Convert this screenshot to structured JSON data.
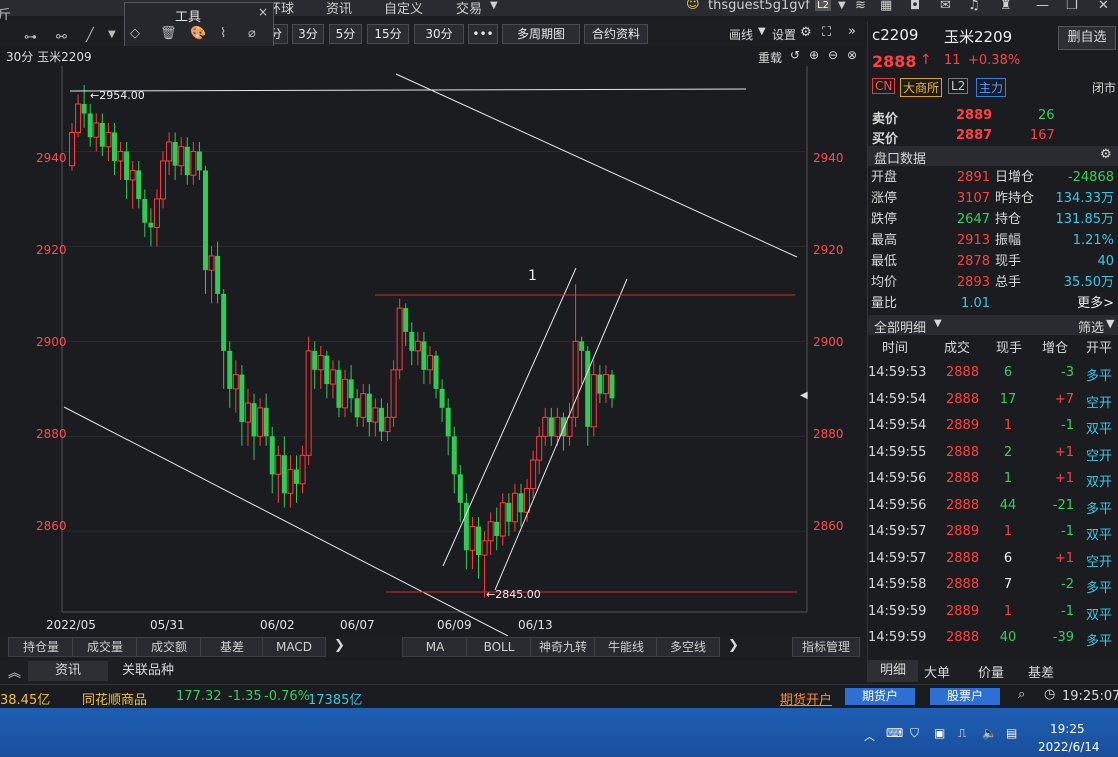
{
  "topbar": {
    "menu": [
      "所",
      "环球",
      "资讯",
      "自定义",
      "交易"
    ],
    "user": "thsguest5g1gvf",
    "l2": "L2"
  },
  "toolbar": {
    "periods": [
      "分",
      "3分",
      "5分",
      "15分",
      "30分",
      "•••",
      "多周期图",
      "合约资料"
    ],
    "right_items": [
      "画线",
      "设置"
    ],
    "tools_title": "工具",
    "zoom_label": "重载"
  },
  "chart": {
    "caption": "30分 玉米2209",
    "high_label": "←2954.00",
    "low_label": "←2845.00",
    "annotation": "1",
    "ylabels": [
      "2940",
      "2920",
      "2900",
      "2880",
      "2860"
    ],
    "xlabels": [
      "2022/05",
      "05/31",
      "06/02",
      "06/07",
      "06/09",
      "06/13"
    ]
  },
  "chart_data": {
    "type": "candlestick",
    "title": "30分 玉米2209",
    "ylim": [
      2843,
      2958
    ],
    "yticks": [
      2860,
      2880,
      2900,
      2920,
      2940
    ],
    "x_categories": [
      "2022/05",
      "05/31",
      "06/02",
      "06/07",
      "06/09",
      "06/13"
    ],
    "annotations": [
      {
        "text": "←2954.00",
        "value": 2954
      },
      {
        "text": "←2845.00",
        "value": 2845
      },
      {
        "text": "1"
      }
    ],
    "candles": [
      [
        2937,
        2944,
        2936,
        2946
      ],
      [
        2944,
        2950,
        2943,
        2952
      ],
      [
        2950,
        2948,
        2945,
        2954
      ],
      [
        2948,
        2943,
        2941,
        2950
      ],
      [
        2943,
        2946,
        2940,
        2948
      ],
      [
        2946,
        2941,
        2939,
        2948
      ],
      [
        2941,
        2944,
        2938,
        2946
      ],
      [
        2944,
        2938,
        2935,
        2946
      ],
      [
        2938,
        2940,
        2934,
        2942
      ],
      [
        2940,
        2934,
        2930,
        2942
      ],
      [
        2934,
        2936,
        2928,
        2938
      ],
      [
        2936,
        2930,
        2928,
        2938
      ],
      [
        2930,
        2925,
        2922,
        2932
      ],
      [
        2925,
        2924,
        2920,
        2928
      ],
      [
        2924,
        2930,
        2920,
        2932
      ],
      [
        2930,
        2938,
        2928,
        2940
      ],
      [
        2938,
        2942,
        2935,
        2944
      ],
      [
        2942,
        2937,
        2934,
        2944
      ],
      [
        2937,
        2941,
        2935,
        2943
      ],
      [
        2941,
        2935,
        2933,
        2943
      ],
      [
        2935,
        2940,
        2933,
        2942
      ],
      [
        2940,
        2936,
        2934,
        2942
      ],
      [
        2936,
        2915,
        2910,
        2937
      ],
      [
        2915,
        2918,
        2908,
        2920
      ],
      [
        2918,
        2910,
        2908,
        2921
      ],
      [
        2910,
        2898,
        2890,
        2911
      ],
      [
        2898,
        2890,
        2886,
        2900
      ],
      [
        2890,
        2893,
        2885,
        2896
      ],
      [
        2893,
        2883,
        2878,
        2895
      ],
      [
        2883,
        2887,
        2878,
        2890
      ],
      [
        2887,
        2880,
        2875,
        2889
      ],
      [
        2880,
        2886,
        2878,
        2888
      ],
      [
        2886,
        2880,
        2878,
        2889
      ],
      [
        2880,
        2872,
        2868,
        2882
      ],
      [
        2872,
        2876,
        2866,
        2878
      ],
      [
        2876,
        2868,
        2865,
        2880
      ],
      [
        2868,
        2873,
        2865,
        2876
      ],
      [
        2873,
        2870,
        2866,
        2876
      ],
      [
        2870,
        2876,
        2868,
        2878
      ],
      [
        2876,
        2898,
        2874,
        2901
      ],
      [
        2898,
        2894,
        2890,
        2900
      ],
      [
        2894,
        2897,
        2890,
        2899
      ],
      [
        2897,
        2891,
        2888,
        2898
      ],
      [
        2891,
        2894,
        2888,
        2896
      ],
      [
        2894,
        2886,
        2884,
        2896
      ],
      [
        2886,
        2892,
        2884,
        2894
      ],
      [
        2892,
        2888,
        2885,
        2895
      ],
      [
        2888,
        2884,
        2882,
        2890
      ],
      [
        2884,
        2889,
        2882,
        2891
      ],
      [
        2889,
        2883,
        2880,
        2891
      ],
      [
        2883,
        2886,
        2880,
        2888
      ],
      [
        2886,
        2881,
        2879,
        2888
      ],
      [
        2881,
        2884,
        2879,
        2887
      ],
      [
        2884,
        2894,
        2882,
        2896
      ],
      [
        2894,
        2907,
        2892,
        2909
      ],
      [
        2907,
        2902,
        2899,
        2908
      ],
      [
        2902,
        2898,
        2895,
        2904
      ],
      [
        2898,
        2900,
        2895,
        2902
      ],
      [
        2900,
        2894,
        2891,
        2902
      ],
      [
        2894,
        2897,
        2891,
        2899
      ],
      [
        2897,
        2890,
        2888,
        2898
      ],
      [
        2890,
        2886,
        2883,
        2892
      ],
      [
        2886,
        2880,
        2876,
        2888
      ],
      [
        2880,
        2872,
        2868,
        2882
      ],
      [
        2872,
        2866,
        2862,
        2874
      ],
      [
        2866,
        2856,
        2852,
        2868
      ],
      [
        2856,
        2861,
        2852,
        2863
      ],
      [
        2861,
        2855,
        2850,
        2863
      ],
      [
        2855,
        2858,
        2846,
        2860
      ],
      [
        2858,
        2862,
        2855,
        2864
      ],
      [
        2862,
        2859,
        2856,
        2865
      ],
      [
        2859,
        2866,
        2857,
        2868
      ],
      [
        2866,
        2862,
        2859,
        2868
      ],
      [
        2862,
        2868,
        2860,
        2870
      ],
      [
        2868,
        2864,
        2861,
        2870
      ],
      [
        2864,
        2869,
        2862,
        2871
      ],
      [
        2869,
        2875,
        2867,
        2877
      ],
      [
        2875,
        2880,
        2872,
        2882
      ],
      [
        2880,
        2884,
        2878,
        2886
      ],
      [
        2884,
        2880,
        2878,
        2886
      ],
      [
        2880,
        2884,
        2878,
        2886
      ],
      [
        2884,
        2880,
        2877,
        2885
      ],
      [
        2880,
        2884,
        2878,
        2887
      ],
      [
        2884,
        2900,
        2882,
        2912
      ],
      [
        2900,
        2898,
        2891,
        2901
      ],
      [
        2898,
        2882,
        2878,
        2899
      ],
      [
        2882,
        2893,
        2880,
        2896
      ],
      [
        2893,
        2889,
        2887,
        2895
      ],
      [
        2889,
        2893,
        2887,
        2895
      ],
      [
        2893,
        2888,
        2886,
        2894
      ]
    ]
  },
  "indicator_tabs": [
    "持仓量",
    "成交量",
    "成交额",
    "基差",
    "MACD"
  ],
  "indicator_tabs2": [
    "MA",
    "BOLL",
    "神奇九转",
    "牛能线",
    "多空线"
  ],
  "indicator_manage": "指标管理",
  "info_tabs": [
    "资讯",
    "关联品种"
  ],
  "quote": {
    "code": "c2209",
    "name": "玉米2209",
    "delete_btn": "删自选",
    "price": "2888",
    "arrow": "↑",
    "change": "11",
    "pct": "+0.38%",
    "tags": [
      "CN",
      "大商所",
      "L2",
      "主力"
    ],
    "close_tag": "闭市",
    "ask_label": "卖价",
    "ask": "2889",
    "ask_vol": "26",
    "bid_label": "买价",
    "bid": "2887",
    "bid_vol": "167",
    "panel_title": "盘口数据"
  },
  "stats": [
    {
      "k": "开盘",
      "v": "2891",
      "c": "red",
      "k2": "日增仓",
      "v2": "-24868",
      "c2": "green"
    },
    {
      "k": "涨停",
      "v": "3107",
      "c": "red",
      "k2": "昨持仓",
      "v2": "134.33万",
      "c2": "cyan"
    },
    {
      "k": "跌停",
      "v": "2647",
      "c": "green",
      "k2": "持仓",
      "v2": "131.85万",
      "c2": "cyan"
    },
    {
      "k": "最高",
      "v": "2913",
      "c": "red",
      "k2": "振幅",
      "v2": "1.21%",
      "c2": "cyan"
    },
    {
      "k": "最低",
      "v": "2878",
      "c": "red",
      "k2": "现手",
      "v2": "40",
      "c2": "cyan"
    },
    {
      "k": "均价",
      "v": "2893",
      "c": "red",
      "k2": "总手",
      "v2": "35.50万",
      "c2": "cyan"
    },
    {
      "k": "量比",
      "v": "1.01",
      "c": "cyan",
      "k2": "",
      "v2": "更多>",
      "c2": "white"
    }
  ],
  "detail": {
    "title": "全部明细",
    "filter": "筛选",
    "headers": [
      "时间",
      "成交",
      "现手",
      "增仓",
      "开平"
    ],
    "rows": [
      {
        "t": "14:59:53",
        "p": "2888",
        "pc": "red",
        "v": "6",
        "vc": "green",
        "d": "-3",
        "dc": "green",
        "o": "多平",
        "oc": "cyan"
      },
      {
        "t": "14:59:54",
        "p": "2888",
        "pc": "red",
        "v": "17",
        "vc": "green",
        "d": "+7",
        "dc": "red",
        "o": "空开",
        "oc": "cyan"
      },
      {
        "t": "14:59:54",
        "p": "2889",
        "pc": "red",
        "v": "1",
        "vc": "red",
        "d": "-1",
        "dc": "green",
        "o": "双平",
        "oc": "cyan"
      },
      {
        "t": "14:59:55",
        "p": "2888",
        "pc": "red",
        "v": "2",
        "vc": "green",
        "d": "+1",
        "dc": "red",
        "o": "空开",
        "oc": "cyan"
      },
      {
        "t": "14:59:56",
        "p": "2888",
        "pc": "red",
        "v": "1",
        "vc": "green",
        "d": "+1",
        "dc": "red",
        "o": "双开",
        "oc": "cyan"
      },
      {
        "t": "14:59:56",
        "p": "2888",
        "pc": "red",
        "v": "44",
        "vc": "green",
        "d": "-21",
        "dc": "green",
        "o": "多平",
        "oc": "cyan"
      },
      {
        "t": "14:59:57",
        "p": "2889",
        "pc": "red",
        "v": "1",
        "vc": "red",
        "d": "-1",
        "dc": "green",
        "o": "双平",
        "oc": "cyan"
      },
      {
        "t": "14:59:57",
        "p": "2888",
        "pc": "red",
        "v": "6",
        "vc": "white",
        "d": "+1",
        "dc": "red",
        "o": "空开",
        "oc": "cyan"
      },
      {
        "t": "14:59:58",
        "p": "2888",
        "pc": "red",
        "v": "7",
        "vc": "white",
        "d": "-2",
        "dc": "green",
        "o": "多平",
        "oc": "cyan"
      },
      {
        "t": "14:59:59",
        "p": "2889",
        "pc": "red",
        "v": "1",
        "vc": "red",
        "d": "-1",
        "dc": "green",
        "o": "双平",
        "oc": "cyan"
      },
      {
        "t": "14:59:59",
        "p": "2888",
        "pc": "red",
        "v": "40",
        "vc": "green",
        "d": "-39",
        "dc": "green",
        "o": "多平",
        "oc": "cyan"
      }
    ]
  },
  "right_tabs": [
    "明细",
    "大单",
    "价量",
    "基差"
  ],
  "status": {
    "left_value": "38.45亿",
    "index_name": "同花顺商品",
    "index_val": "177.32",
    "index_chg": "-1.35",
    "index_pct": "-0.76%",
    "index_amt": "17385亿",
    "promo": "期货开户",
    "btn1": "期货户",
    "btn2": "股票户",
    "time": "19:25:07"
  },
  "taskbar": {
    "time": "19:25",
    "date": "2022/6/14"
  }
}
